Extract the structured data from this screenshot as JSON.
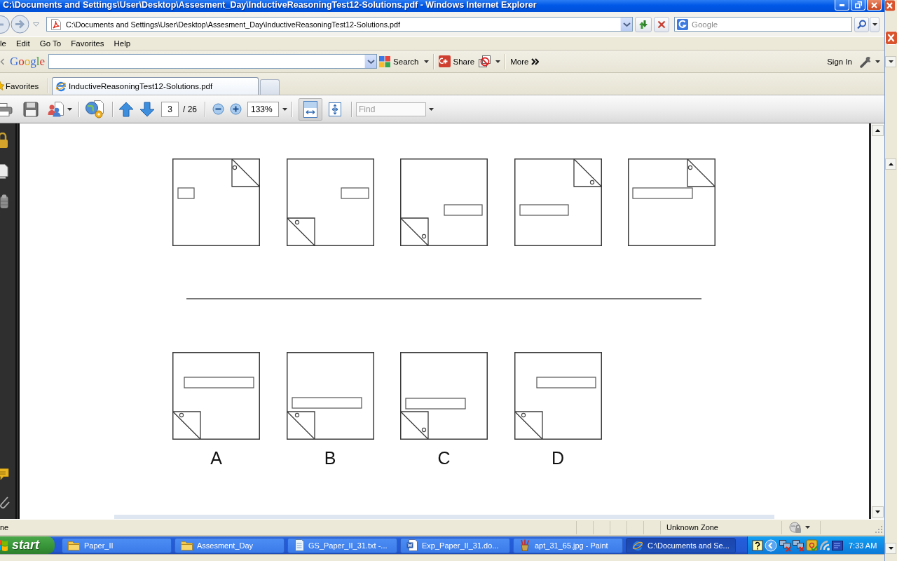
{
  "window": {
    "title": "C:\\Documents and Settings\\User\\Desktop\\Assesment_Day\\InductiveReasoningTest12-Solutions.pdf - Windows Internet Explorer"
  },
  "address_bar": {
    "url": "C:\\Documents and Settings\\User\\Desktop\\Assesment_Day\\InductiveReasoningTest12-Solutions.pdf"
  },
  "search_box": {
    "placeholder": "Google"
  },
  "menu": [
    "le",
    "Edit",
    "Go To",
    "Favorites",
    "Help"
  ],
  "google_toolbar": {
    "logo": "Google",
    "buttons": [
      {
        "kind": "search",
        "label": "Search"
      },
      {
        "kind": "share",
        "label": "Share"
      },
      {
        "kind": "more",
        "label": "More"
      }
    ],
    "sign_in": "Sign In"
  },
  "favorites": "Favorites",
  "tabs": [
    {
      "label": "InductiveReasoningTest12-Solutions.pdf",
      "selected": true
    }
  ],
  "pdf_toolbar": {
    "page": "3",
    "page_count": "/ 26",
    "zoom": "133%",
    "find_placeholder": "Find",
    "view_buttons": [
      {
        "kind": "fit-width",
        "selected": true
      },
      {
        "kind": "fit-page",
        "selected": false
      }
    ]
  },
  "document": {
    "options": [
      {
        "label": "A"
      },
      {
        "label": "B"
      },
      {
        "label": "C"
      },
      {
        "label": "D"
      }
    ]
  },
  "status_bar": {
    "text": "ne",
    "zone": "Unknown Zone"
  },
  "taskbar": {
    "start": "start",
    "tasks": [
      {
        "kind": "folder",
        "label": "Paper_II",
        "selected": false
      },
      {
        "kind": "folder",
        "label": "Assesment_Day",
        "selected": false
      },
      {
        "kind": "text",
        "label": "GS_Paper_II_31.txt -...",
        "selected": false
      },
      {
        "kind": "word",
        "label": "Exp_Paper_II_31.do...",
        "selected": false
      },
      {
        "kind": "paint",
        "label": "apt_31_65.jpg - Paint",
        "selected": false
      },
      {
        "kind": "browser",
        "label": "C:\\Documents and Se...",
        "selected": true
      }
    ],
    "clock": "7:33 AM"
  }
}
